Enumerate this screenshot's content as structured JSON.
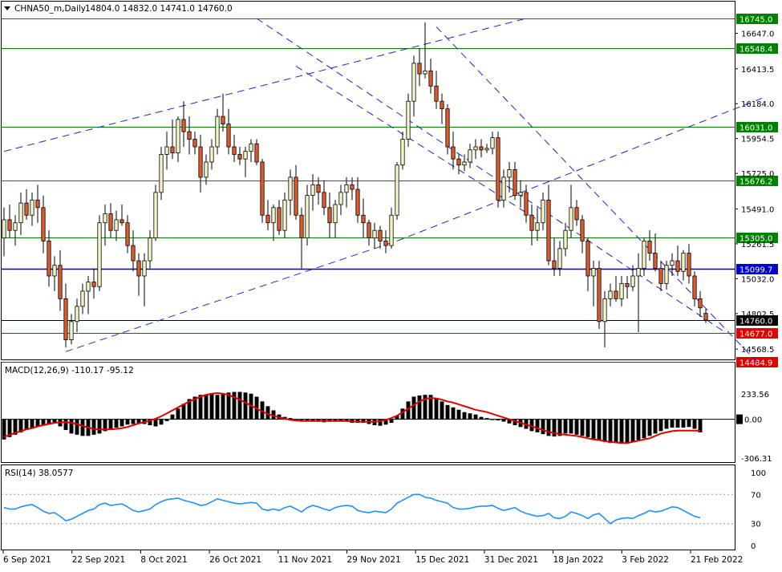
{
  "header": {
    "symbol_label": "CHNA50_m,Daily",
    "ohlc_text": "14804.0 14832.0 14741.0 14760.0"
  },
  "colors": {
    "up_candle": "#f5f5c8",
    "down_candle": "#e05a2a",
    "candle_border": "#000000",
    "grid_green": "#008000",
    "blue_line": "#0000c8",
    "red_line": "#e00000",
    "macd_histogram": "#000000",
    "macd_signal": "#e00000",
    "rsi_line": "#1e90ff",
    "trendline": "#2020d0"
  },
  "chart_data": [
    {
      "type": "candlestick",
      "panel": "price",
      "title": "CHNA50_m,Daily",
      "last_ohlc": {
        "open": 14804.0,
        "high": 14832.0,
        "low": 14741.0,
        "close": 14760.0
      },
      "ylim": [
        14484.9,
        16745.0
      ],
      "y_tick_labels": [
        "16647.0",
        "16413.5",
        "16184.0",
        "15954.5",
        "15725.0",
        "15491.0",
        "15261.5",
        "15032.0",
        "14802.5",
        "14568.5"
      ],
      "x_tick_labels": [
        "6 Sep 2021",
        "22 Sep 2021",
        "8 Oct 2021",
        "26 Oct 2021",
        "11 Nov 2021",
        "29 Nov 2021",
        "15 Dec 2021",
        "31 Dec 2021",
        "18 Jan 2022",
        "3 Feb 2022",
        "21 Feb 2022"
      ],
      "horizontal_levels": [
        {
          "value": 16745.0,
          "label": "16745.0",
          "color": "#008000"
        },
        {
          "value": 16548.4,
          "label": "16548.4",
          "color": "#008000"
        },
        {
          "value": 16031.0,
          "label": "16031.0",
          "color": "#008000"
        },
        {
          "value": 15676.2,
          "label": "15676.2",
          "color": "#008000"
        },
        {
          "value": 15305.0,
          "label": "15305.0",
          "color": "#008000"
        },
        {
          "value": 15099.7,
          "label": "15099.7",
          "color": "#0000c8"
        },
        {
          "value": 14760.0,
          "label": "14760.0",
          "color": "#000000"
        },
        {
          "value": 14677.0,
          "label": "14677.0",
          "color": "#e00000"
        },
        {
          "value": 14484.9,
          "label": "14484.9",
          "color": "#e00000"
        }
      ],
      "candles": [
        [
          15300,
          15500,
          15180,
          15420
        ],
        [
          15420,
          15520,
          15300,
          15350
        ],
        [
          15350,
          15450,
          15250,
          15400
        ],
        [
          15400,
          15600,
          15320,
          15530
        ],
        [
          15530,
          15620,
          15420,
          15450
        ],
        [
          15450,
          15600,
          15380,
          15550
        ],
        [
          15550,
          15650,
          15400,
          15500
        ],
        [
          15500,
          15580,
          15200,
          15280
        ],
        [
          15280,
          15350,
          14980,
          15050
        ],
        [
          15050,
          15180,
          14950,
          15120
        ],
        [
          15120,
          15220,
          14820,
          14900
        ],
        [
          14900,
          15000,
          14580,
          14630
        ],
        [
          14630,
          14800,
          14600,
          14750
        ],
        [
          14750,
          14900,
          14680,
          14850
        ],
        [
          14850,
          15000,
          14800,
          14950
        ],
        [
          14950,
          15050,
          14800,
          15010
        ],
        [
          15010,
          15100,
          14900,
          14980
        ],
        [
          14980,
          15450,
          14950,
          15400
        ],
        [
          15400,
          15520,
          15250,
          15460
        ],
        [
          15460,
          15530,
          15300,
          15350
        ],
        [
          15350,
          15480,
          15280,
          15420
        ],
        [
          15420,
          15520,
          15380,
          15400
        ],
        [
          15400,
          15450,
          15200,
          15250
        ],
        [
          15250,
          15350,
          15080,
          15150
        ],
        [
          15150,
          15200,
          14920,
          15050
        ],
        [
          15050,
          15200,
          14850,
          15150
        ],
        [
          15150,
          15350,
          15100,
          15300
        ],
        [
          15300,
          15650,
          15280,
          15600
        ],
        [
          15600,
          15900,
          15550,
          15850
        ],
        [
          15850,
          16000,
          15750,
          15900
        ],
        [
          15900,
          16080,
          15820,
          15860
        ],
        [
          15860,
          16100,
          15800,
          16080
        ],
        [
          16080,
          16200,
          15900,
          16000
        ],
        [
          16000,
          16100,
          15850,
          15950
        ],
        [
          15950,
          16000,
          15850,
          15900
        ],
        [
          15900,
          15980,
          15600,
          15700
        ],
        [
          15700,
          15850,
          15650,
          15800
        ],
        [
          15800,
          15950,
          15750,
          15900
        ],
        [
          15900,
          16150,
          15850,
          16100
        ],
        [
          16100,
          16250,
          16000,
          16050
        ],
        [
          16050,
          16150,
          15850,
          15900
        ],
        [
          15900,
          15980,
          15800,
          15850
        ],
        [
          15850,
          15900,
          15780,
          15820
        ],
        [
          15820,
          15900,
          15700,
          15870
        ],
        [
          15870,
          15950,
          15800,
          15920
        ],
        [
          15920,
          15950,
          15780,
          15800
        ],
        [
          15800,
          15820,
          15400,
          15450
        ],
        [
          15450,
          15550,
          15350,
          15400
        ],
        [
          15400,
          15520,
          15280,
          15500
        ],
        [
          15500,
          15550,
          15320,
          15350
        ],
        [
          15350,
          15600,
          15300,
          15550
        ],
        [
          15550,
          15750,
          15450,
          15700
        ],
        [
          15700,
          15780,
          15420,
          15450
        ],
        [
          15450,
          15500,
          15100,
          15300
        ],
        [
          15300,
          15650,
          15250,
          15580
        ],
        [
          15580,
          15720,
          15480,
          15650
        ],
        [
          15650,
          15700,
          15520,
          15600
        ],
        [
          15600,
          15680,
          15450,
          15500
        ],
        [
          15500,
          15600,
          15300,
          15400
        ],
        [
          15400,
          15550,
          15300,
          15520
        ],
        [
          15520,
          15650,
          15450,
          15600
        ],
        [
          15600,
          15700,
          15500,
          15650
        ],
        [
          15650,
          15700,
          15550,
          15620
        ],
        [
          15620,
          15700,
          15400,
          15450
        ],
        [
          15450,
          15560,
          15300,
          15400
        ],
        [
          15400,
          15420,
          15250,
          15300
        ],
        [
          15300,
          15400,
          15230,
          15350
        ],
        [
          15350,
          15380,
          15230,
          15280
        ],
        [
          15280,
          15350,
          15200,
          15250
        ],
        [
          15250,
          15500,
          15230,
          15450
        ],
        [
          15450,
          15800,
          15420,
          15780
        ],
        [
          15780,
          16000,
          15750,
          15950
        ],
        [
          15950,
          16250,
          15900,
          16200
        ],
        [
          16200,
          16500,
          16100,
          16450
        ],
        [
          16450,
          16550,
          16300,
          16380
        ],
        [
          16380,
          16720,
          16350,
          16400
        ],
        [
          16400,
          16480,
          16250,
          16300
        ],
        [
          16300,
          16400,
          16150,
          16200
        ],
        [
          16200,
          16250,
          16050,
          16150
        ],
        [
          16150,
          16180,
          15850,
          15900
        ],
        [
          15900,
          16000,
          15750,
          15820
        ],
        [
          15820,
          15850,
          15720,
          15780
        ],
        [
          15780,
          15850,
          15740,
          15800
        ],
        [
          15800,
          15920,
          15760,
          15880
        ],
        [
          15880,
          15950,
          15820,
          15900
        ],
        [
          15900,
          15950,
          15830,
          15880
        ],
        [
          15880,
          15920,
          15860,
          15890
        ],
        [
          15890,
          16000,
          15850,
          15960
        ],
        [
          15960,
          16000,
          15500,
          15550
        ],
        [
          15550,
          15750,
          15500,
          15700
        ],
        [
          15700,
          15800,
          15600,
          15750
        ],
        [
          15750,
          15800,
          15550,
          15580
        ],
        [
          15580,
          15680,
          15500,
          15600
        ],
        [
          15600,
          15650,
          15400,
          15450
        ],
        [
          15450,
          15520,
          15250,
          15350
        ],
        [
          15350,
          15500,
          15280,
          15400
        ],
        [
          15400,
          15600,
          15350,
          15550
        ],
        [
          15550,
          15650,
          15120,
          15150
        ],
        [
          15150,
          15300,
          15050,
          15100
        ],
        [
          15100,
          15280,
          15050,
          15230
        ],
        [
          15230,
          15400,
          15180,
          15350
        ],
        [
          15350,
          15650,
          15300,
          15500
        ],
        [
          15500,
          15550,
          15380,
          15420
        ],
        [
          15420,
          15450,
          15200,
          15280
        ],
        [
          15280,
          15300,
          14950,
          15050
        ],
        [
          15050,
          15150,
          14850,
          15100
        ],
        [
          15100,
          15150,
          14700,
          14750
        ],
        [
          14750,
          14950,
          14580,
          14900
        ],
        [
          14900,
          15000,
          14850,
          14950
        ],
        [
          14950,
          15050,
          14880,
          14900
        ],
        [
          14900,
          15050,
          14850,
          15000
        ],
        [
          15000,
          15050,
          14900,
          14980
        ],
        [
          14980,
          15120,
          14950,
          15050
        ],
        [
          15050,
          15200,
          14680,
          15100
        ],
        [
          15100,
          15300,
          15050,
          15280
        ],
        [
          15280,
          15350,
          15150,
          15200
        ],
        [
          15200,
          15330,
          15080,
          15100
        ],
        [
          15100,
          15150,
          14950,
          15000
        ],
        [
          15000,
          15150,
          14960,
          15120
        ],
        [
          15120,
          15200,
          15050,
          15150
        ],
        [
          15150,
          15250,
          15050,
          15080
        ],
        [
          15080,
          15220,
          15020,
          15200
        ],
        [
          15200,
          15260,
          15000,
          15050
        ],
        [
          15050,
          15080,
          14850,
          14900
        ],
        [
          14900,
          14950,
          14780,
          14840
        ],
        [
          14804,
          14832,
          14741,
          14760
        ]
      ],
      "trendlines": [
        {
          "kind": "channel-upper",
          "from": [
            0,
            15870
          ],
          "to": [
            93,
            16745
          ]
        },
        {
          "kind": "channel-lower",
          "from": [
            11,
            14552
          ],
          "to": [
            70,
            15280
          ]
        },
        {
          "kind": "rising-line",
          "from": [
            70,
            15280
          ],
          "to": [
            135,
            16220
          ]
        },
        {
          "kind": "falling-line",
          "from": [
            45,
            16745
          ],
          "to": [
            128,
            14690
          ]
        },
        {
          "kind": "falling-line",
          "from": [
            77,
            16690
          ],
          "to": [
            135,
            14450
          ]
        },
        {
          "kind": "falling-line",
          "from": [
            52,
            16431
          ],
          "to": [
            95,
            15420
          ]
        }
      ]
    },
    {
      "type": "bar",
      "panel": "macd",
      "title": "MACD(12,26,9) -110.17 -95.12",
      "ylim": [
        -306.31,
        233.56
      ],
      "y_tick_labels": [
        "233.56",
        "0.00",
        "-306.31"
      ],
      "histogram": [
        -170,
        -150,
        -130,
        -110,
        -90,
        -80,
        -60,
        -50,
        -40,
        -35,
        -60,
        -90,
        -120,
        -130,
        -140,
        -140,
        -130,
        -120,
        -100,
        -90,
        -70,
        -60,
        -45,
        -40,
        -35,
        -40,
        -50,
        -60,
        -45,
        -15,
        40,
        90,
        130,
        170,
        190,
        205,
        210,
        210,
        205,
        215,
        225,
        230,
        230,
        225,
        215,
        190,
        150,
        110,
        75,
        40,
        20,
        10,
        0,
        -15,
        -15,
        -15,
        -20,
        -25,
        -20,
        -20,
        -10,
        -20,
        -30,
        -30,
        -30,
        -40,
        -50,
        -55,
        -45,
        -30,
        30,
        90,
        150,
        190,
        200,
        205,
        205,
        180,
        150,
        120,
        100,
        80,
        60,
        50,
        40,
        20,
        10,
        0,
        -10,
        -20,
        -35,
        -50,
        -65,
        -80,
        -100,
        -110,
        -125,
        -140,
        -145,
        -140,
        -120,
        -120,
        -130,
        -140,
        -150,
        -165,
        -180,
        -190,
        -200,
        -200,
        -200,
        -200,
        -190,
        -175,
        -160,
        -140,
        -120,
        -100,
        -80,
        -70,
        -70,
        -70,
        -65,
        -80,
        -110
      ],
      "signal": [
        -150,
        -130,
        -115,
        -100,
        -85,
        -75,
        -60,
        -50,
        -40,
        -30,
        -25,
        -25,
        -30,
        -40,
        -55,
        -70,
        -80,
        -85,
        -85,
        -85,
        -80,
        -75,
        -65,
        -50,
        -35,
        -25,
        -10,
        5,
        25,
        50,
        75,
        100,
        125,
        150,
        170,
        190,
        205,
        215,
        220,
        215,
        205,
        185,
        165,
        140,
        115,
        90,
        65,
        45,
        30,
        15,
        5,
        -5,
        -10,
        -15,
        -15,
        -15,
        -15,
        -15,
        -15,
        -15,
        -15,
        -15,
        -18,
        -20,
        -20,
        -20,
        -20,
        -15,
        -5,
        10,
        30,
        60,
        90,
        120,
        150,
        170,
        180,
        175,
        165,
        150,
        140,
        125,
        110,
        95,
        80,
        70,
        60,
        45,
        30,
        15,
        0,
        -15,
        -30,
        -45,
        -60,
        -75,
        -90,
        -105,
        -115,
        -125,
        -130,
        -135,
        -140,
        -150,
        -160,
        -170,
        -175,
        -185,
        -190,
        -195,
        -200,
        -200,
        -190,
        -180,
        -170,
        -160,
        -140,
        -120,
        -110,
        -100,
        -95,
        -95,
        -95,
        -95,
        -95
      ]
    },
    {
      "type": "line",
      "panel": "rsi",
      "title": "RSI(14) 38.0577",
      "ylim": [
        0,
        100
      ],
      "y_tick_labels": [
        "100",
        "70",
        "30",
        "0"
      ],
      "levels": [
        70,
        30
      ],
      "values": [
        52,
        50,
        50,
        53,
        55,
        56,
        52,
        47,
        44,
        45,
        40,
        34,
        36,
        40,
        44,
        48,
        50,
        56,
        58,
        55,
        56,
        57,
        53,
        48,
        46,
        48,
        50,
        56,
        60,
        63,
        64,
        65,
        62,
        60,
        58,
        55,
        56,
        60,
        64,
        62,
        60,
        58,
        57,
        58,
        59,
        58,
        50,
        48,
        50,
        48,
        52,
        54,
        50,
        46,
        52,
        55,
        53,
        50,
        48,
        52,
        54,
        55,
        54,
        48,
        46,
        45,
        47,
        46,
        45,
        50,
        58,
        62,
        66,
        70,
        70,
        66,
        65,
        62,
        60,
        58,
        52,
        50,
        50,
        51,
        53,
        54,
        54,
        55,
        51,
        48,
        50,
        52,
        47,
        44,
        42,
        40,
        41,
        44,
        38,
        37,
        40,
        46,
        44,
        41,
        37,
        42,
        44,
        37,
        30,
        35,
        37,
        38,
        37,
        41,
        44,
        48,
        46,
        47,
        50,
        53,
        52,
        48,
        44,
        40,
        38
      ]
    }
  ]
}
